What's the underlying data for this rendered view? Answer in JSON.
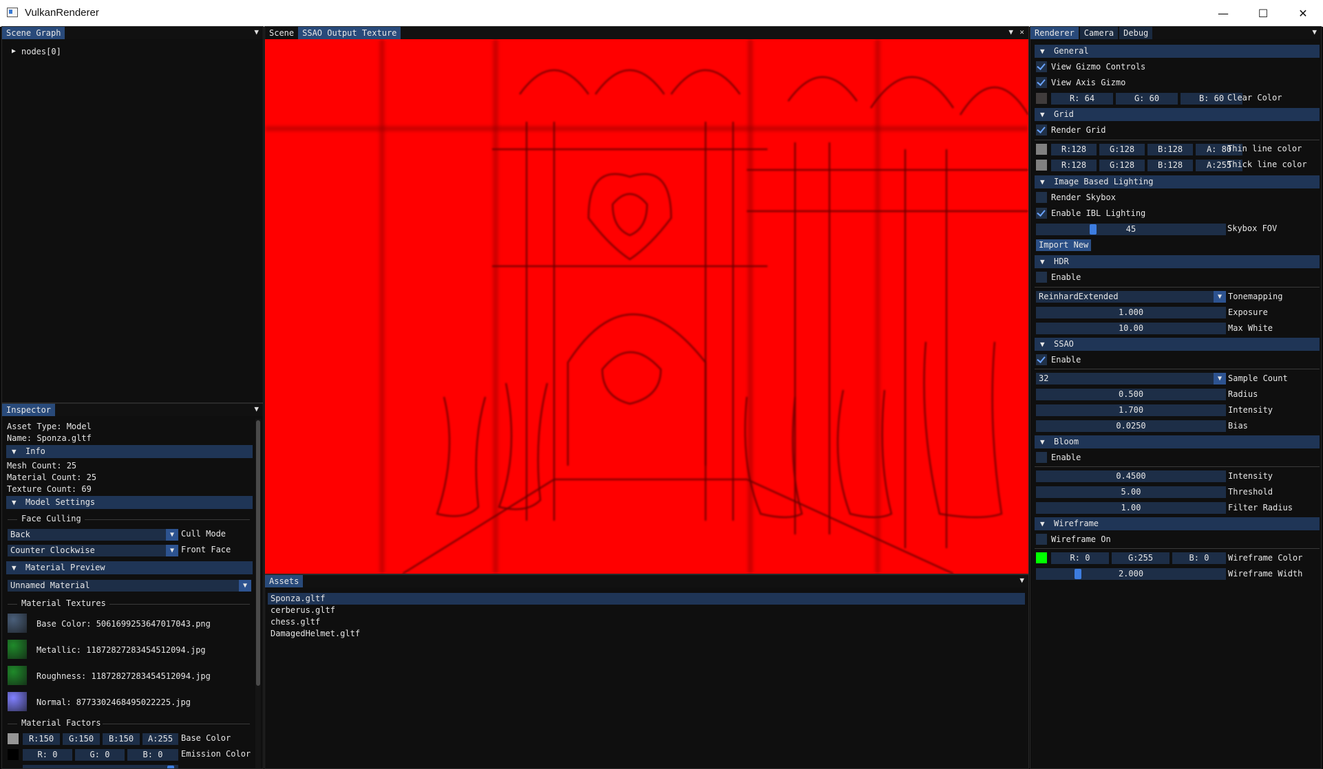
{
  "window": {
    "title": "VulkanRenderer",
    "minimize": "—",
    "maximize": "☐",
    "close": "✕"
  },
  "scene_graph": {
    "tab": "Scene Graph",
    "nodes": [
      "nodes[0]"
    ]
  },
  "inspector": {
    "tab": "Inspector",
    "asset_type": "Asset Type: Model",
    "name": "Name: Sponza.gltf",
    "info_header": "Info",
    "mesh_count": "Mesh Count: 25",
    "material_count": "Material Count: 25",
    "texture_count": "Texture Count: 69",
    "model_settings_header": "Model Settings",
    "face_culling": "Face Culling",
    "cull_mode_value": "Back",
    "cull_mode_label": "Cull Mode",
    "front_face_value": "Counter Clockwise",
    "front_face_label": "Front Face",
    "material_preview_header": "Material Preview",
    "material_value": "Unnamed Material",
    "material_textures": "Material Textures",
    "textures": [
      {
        "label": "Base Color: 5061699253647017043.png",
        "color": "#4a5f7a"
      },
      {
        "label": "Metallic: 11872827283454512094.jpg",
        "color": "#1f8a2a"
      },
      {
        "label": "Roughness: 11872827283454512094.jpg",
        "color": "#1f8a2a"
      },
      {
        "label": "Normal: 8773302468495022225.jpg",
        "color": "#8080ff"
      }
    ],
    "material_factors": "Material Factors",
    "base_color": {
      "r": "R:150",
      "g": "G:150",
      "b": "B:150",
      "a": "A:255",
      "label": "Base Color",
      "swatch": "#969696"
    },
    "emission_color": {
      "r": "R:  0",
      "g": "G:  0",
      "b": "B:  0",
      "label": "Emission Color",
      "swatch": "#000000"
    }
  },
  "viewport": {
    "tabs": [
      "Scene",
      "SSAO Output Texture"
    ],
    "active_tab": "SSAO Output Texture",
    "background": "#ff0000"
  },
  "assets": {
    "tab": "Assets",
    "items": [
      "Sponza.gltf",
      "cerberus.gltf",
      "chess.gltf",
      "DamagedHelmet.gltf"
    ],
    "selected": "Sponza.gltf"
  },
  "renderer": {
    "tabs": [
      "Renderer",
      "Camera",
      "Debug"
    ],
    "general": {
      "header": "General",
      "view_gizmo": "View Gizmo Controls",
      "view_axis": "View Axis Gizmo",
      "clear_color": {
        "r": "R: 64",
        "g": "G: 60",
        "b": "B: 60",
        "label": "Clear Color",
        "swatch": "#403c3c"
      }
    },
    "grid": {
      "header": "Grid",
      "render_grid": "Render Grid",
      "thin": {
        "r": "R:128",
        "g": "G:128",
        "b": "B:128",
        "a": "A: 80",
        "label": "Thin line color",
        "swatch": "#808080"
      },
      "thick": {
        "r": "R:128",
        "g": "G:128",
        "b": "B:128",
        "a": "A:255",
        "label": "Thick line color",
        "swatch": "#808080"
      }
    },
    "ibl": {
      "header": "Image Based Lighting",
      "render_skybox": "Render Skybox",
      "enable_ibl": "Enable IBL Lighting",
      "skybox_fov_value": "45",
      "skybox_fov_label": "Skybox FOV",
      "import_new": "Import New"
    },
    "hdr": {
      "header": "HDR",
      "enable": "Enable",
      "tonemapping_value": "ReinhardExtended",
      "tonemapping_label": "Tonemapping",
      "exposure_value": "1.000",
      "exposure_label": "Exposure",
      "max_white_value": "10.00",
      "max_white_label": "Max White"
    },
    "ssao": {
      "header": "SSAO",
      "enable": "Enable",
      "sample_count_value": "32",
      "sample_count_label": "Sample Count",
      "radius_value": "0.500",
      "radius_label": "Radius",
      "intensity_value": "1.700",
      "intensity_label": "Intensity",
      "bias_value": "0.0250",
      "bias_label": "Bias"
    },
    "bloom": {
      "header": "Bloom",
      "enable": "Enable",
      "intensity_value": "0.4500",
      "intensity_label": "Intensity",
      "threshold_value": "5.00",
      "threshold_label": "Threshold",
      "filter_radius_value": "1.00",
      "filter_radius_label": "Filter Radius"
    },
    "wireframe": {
      "header": "Wireframe",
      "wireframe_on": "Wireframe On",
      "color": {
        "r": "R:  0",
        "g": "G:255",
        "b": "B:  0",
        "label": "Wireframe Color",
        "swatch": "#00ff00"
      },
      "width_value": "2.000",
      "width_label": "Wireframe Width"
    }
  }
}
